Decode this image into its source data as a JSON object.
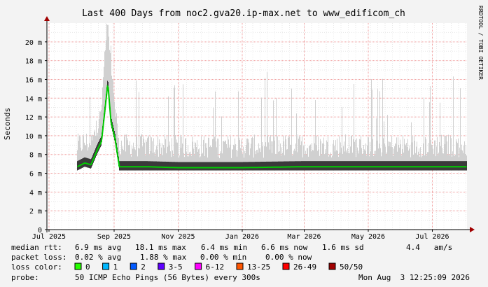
{
  "title": "Last 400 Days from noc2.gva20.ip-max.net to www_edificom_ch",
  "watermark": "RRDTOOL / TOBI OETIKER",
  "colors": {
    "background": "#f3f3f3",
    "plot_bg": "#ffffff",
    "grid_minor": "#e8e8e8",
    "grid_major": "#f0a0a0",
    "median": "#00cc00",
    "smoke": "#000000",
    "axis": "#000000"
  },
  "chart_data": {
    "type": "area",
    "ylabel": "Seconds",
    "y_ticks": [
      "0",
      "2 m",
      "4 m",
      "6 m",
      "8 m",
      "10 m",
      "12 m",
      "14 m",
      "16 m",
      "18 m",
      "20 m"
    ],
    "y_tick_values_ms": [
      0,
      2,
      4,
      6,
      8,
      10,
      12,
      14,
      16,
      18,
      20
    ],
    "ylim_ms": [
      0,
      22
    ],
    "x_ticks": [
      "Jul 2025",
      "Sep 2025",
      "Nov 2025",
      "Jan 2026",
      "Mar 2026",
      "May 2026",
      "Jul 2026"
    ],
    "x_tick_dates": [
      "2025-07-01",
      "2025-09-01",
      "2025-11-01",
      "2026-01-01",
      "2026-03-01",
      "2026-05-01",
      "2026-07-01"
    ],
    "xlim": [
      "2025-06-29",
      "2026-08-03"
    ],
    "data_start": "2025-07-28",
    "median_series_ms": [
      [
        "2025-07-28",
        6.7
      ],
      [
        "2025-08-04",
        7.1
      ],
      [
        "2025-08-10",
        6.9
      ],
      [
        "2025-08-16",
        8.5
      ],
      [
        "2025-08-20",
        9.4
      ],
      [
        "2025-08-24",
        13.5
      ],
      [
        "2025-08-26",
        15.6
      ],
      [
        "2025-08-29",
        11.5
      ],
      [
        "2025-09-02",
        9.6
      ],
      [
        "2025-09-06",
        6.7
      ],
      [
        "2025-10-01",
        6.7
      ],
      [
        "2025-11-01",
        6.6
      ],
      [
        "2026-01-01",
        6.6
      ],
      [
        "2026-03-01",
        6.7
      ],
      [
        "2026-05-01",
        6.7
      ],
      [
        "2026-08-03",
        6.7
      ]
    ],
    "peak_max_ms": 21.8,
    "grid": true
  },
  "legend": {
    "median_rtt": {
      "label": "median rtt:",
      "avg": "6.9 ms avg",
      "max": "18.1 ms max",
      "min": "6.4 ms min",
      "now": "6.6 ms now",
      "sd": "1.6 ms sd",
      "amps": "4.4   am/s"
    },
    "packet_loss": {
      "label": "packet loss:",
      "avg": "0.02 % avg",
      "max": "1.88 % max",
      "min": "0.00 % min",
      "now": "0.00 % now"
    },
    "loss_color": {
      "label": "loss color:",
      "items": [
        {
          "label": "0",
          "color": "#26ff00"
        },
        {
          "label": "1",
          "color": "#00b8ff"
        },
        {
          "label": "2",
          "color": "#0059ff"
        },
        {
          "label": "3-5",
          "color": "#5e00ff"
        },
        {
          "label": "6-12",
          "color": "#ff00ff"
        },
        {
          "label": "13-25",
          "color": "#ff5500"
        },
        {
          "label": "26-49",
          "color": "#ff0000"
        },
        {
          "label": "50/50",
          "color": "#a10000"
        }
      ]
    },
    "probe": {
      "label": "probe:",
      "value": "50 ICMP Echo Pings (56 Bytes) every 300s"
    },
    "timestamp": "Mon Aug  3 12:25:09 2026"
  }
}
